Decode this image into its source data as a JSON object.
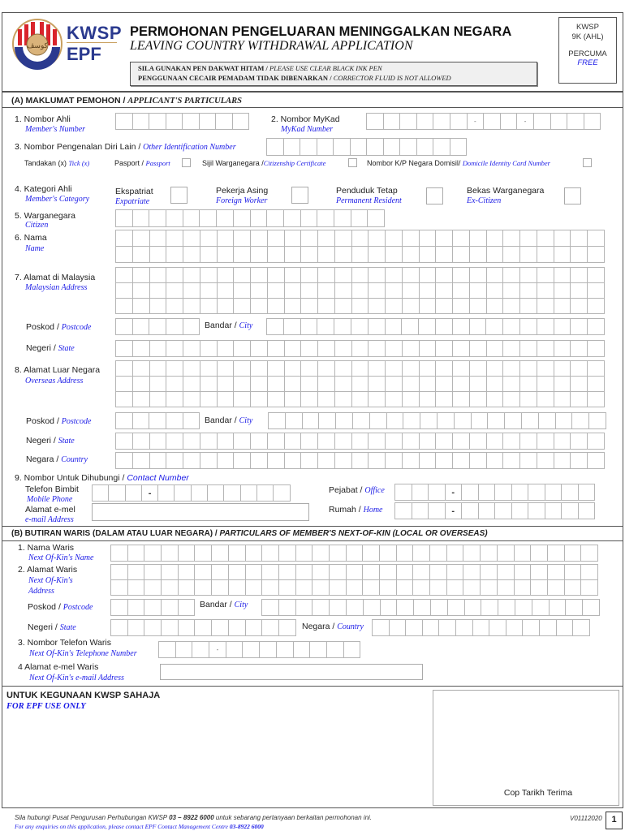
{
  "header": {
    "logo_text_top": "KWSP",
    "logo_text_bottom": "EPF",
    "title_ms": "PERMOHONAN PENGELUARAN MENINGGALKAN NEGARA",
    "title_en": "LEAVING COUNTRY WITHDRAWAL APPLICATION",
    "notice_line1_ms": "SILA GUNAKAN PEN DAKWAT HITAM",
    "notice_line1_en": "PLEASE USE CLEAR BLACK INK PEN",
    "notice_line2_ms": "PENGGUNAAN CECAIR PEMADAM TIDAK DIBENARKAN",
    "notice_line2_en": "CORRECTOR FLUID IS NOT ALLOWED",
    "separator": " / ",
    "form_code_line1": "KWSP",
    "form_code_line2": "9K (AHL)",
    "price_ms": "PERCUMA",
    "price_en": "FREE",
    "colors": {
      "brand_blue": "#2b3a8f",
      "brand_red": "#d9242b",
      "accent_gold": "#c9a060",
      "english_text": "#1a1ae6"
    }
  },
  "section_a": {
    "title_ms": "(A)  MAKLUMAT PEMOHON / ",
    "title_en": "APPLICANT'S PARTICULARS",
    "member_number": {
      "label": "1. Nombor Ahli",
      "label_en": "Member's Number",
      "cells": 8
    },
    "mykad": {
      "label": "2. Nombor MyKad",
      "label_en": "MyKad Number",
      "cells": 14,
      "separator": "-"
    },
    "other_id": {
      "label": "3. Nombor Pengenalan Diri Lain / ",
      "label_en": "Other Identification Number",
      "cells": 12
    },
    "tick": {
      "label": "Tandakan (x) ",
      "label_en": "Tick (x)",
      "options": [
        {
          "label": "Pasport / ",
          "label_en": "Passport",
          "checked": false
        },
        {
          "label": "Sijil Warganegara /",
          "label_en": "Citizenship Certificate",
          "checked": false
        },
        {
          "label": "Nombor K/P Negara Domisil/ ",
          "label_en": "Domicile Identity Card Number",
          "checked": false
        }
      ]
    },
    "category": {
      "label": "4. Kategori Ahli",
      "label_en": "Member's Category",
      "options": [
        {
          "label": "Ekspatriat",
          "label_en": "Expatriate",
          "checked": false
        },
        {
          "label": "Pekerja Asing",
          "label_en": "Foreign Worker",
          "checked": false
        },
        {
          "label": "Penduduk Tetap",
          "label_en": "Permanent Resident",
          "checked": false
        },
        {
          "label": "Bekas Warganegara",
          "label_en": "Ex-Citizen",
          "checked": false
        }
      ]
    },
    "citizen": {
      "label": "5. Warganegara",
      "label_en": "Citizen",
      "cells": 16
    },
    "name": {
      "label": "6. Nama",
      "label_en": "Name",
      "cells": 29,
      "rows": 2
    },
    "malaysian_address": {
      "label": "7. Alamat di Malaysia",
      "label_en": "Malaysian Address",
      "cells": 29,
      "rows": 3,
      "postcode_label": "Poskod / ",
      "postcode_label_en": "Postcode",
      "postcode_cells": 5,
      "city_label": "Bandar / ",
      "city_label_en": "City",
      "city_cells": 20,
      "state_label": "Negeri / ",
      "state_label_en": "State",
      "state_cells": 29
    },
    "overseas_address": {
      "label": "8. Alamat Luar Negara",
      "label_en": "Overseas Address",
      "cells": 29,
      "rows": 3,
      "postcode_label": "Poskod / ",
      "postcode_label_en": "Postcode",
      "postcode_cells": 5,
      "city_label": "Bandar / ",
      "city_label_en": "City",
      "city_cells": 20,
      "state_label": "Negeri / ",
      "state_label_en": "State",
      "state_cells": 29,
      "country_label": "Negara / ",
      "country_label_en": "Country",
      "country_cells": 29
    },
    "contact": {
      "label": "9. Nombor Untuk Dihubungi / ",
      "label_en": "Contact Number",
      "mobile_label": "Telefon Bimbit",
      "mobile_label_en": "Mobile Phone",
      "mobile_cells": 12,
      "email_label": "Alamat e-mel",
      "email_label_en": "e-mail Address",
      "email_value": "",
      "office_label": "Pejabat / ",
      "office_label_en": "Office",
      "office_cells": 12,
      "home_label": "Rumah / ",
      "home_label_en": "Home",
      "home_cells": 12,
      "separator": "-"
    }
  },
  "section_b": {
    "title_ms": "(B)  BUTIRAN WARIS (DALAM ATAU LUAR NEGARA) / ",
    "title_en": "PARTICULARS OF MEMBER'S NEXT-OF-KIN (LOCAL OR OVERSEAS)",
    "name": {
      "label": "1. Nama Waris",
      "label_en": "Next Of-Kin's Name",
      "cells": 29
    },
    "address": {
      "label": "2. Alamat Waris",
      "label_en_1": "Next Of-Kin's",
      "label_en_2": "Address",
      "cells": 29,
      "rows": 2,
      "postcode_label": "Poskod / ",
      "postcode_label_en": "Postcode",
      "postcode_cells": 5,
      "city_label": "Bandar / ",
      "city_label_en": "City",
      "city_cells": 20,
      "state_label": "Negeri / ",
      "state_label_en": "State",
      "state_cells": 11,
      "country_label": "Negara / ",
      "country_label_en": "Country",
      "country_cells": 13
    },
    "phone": {
      "label": "3. Nombor Telefon Waris",
      "label_en": "Next Of-Kin's Telephone Number",
      "cells": 12,
      "separator": "-"
    },
    "email": {
      "label": "4   Alamat e-mel Waris",
      "label_en": "Next Of-Kin's e-mail Address",
      "value": ""
    }
  },
  "office_use": {
    "title_ms": "UNTUK KEGUNAAN KWSP SAHAJA",
    "title_en": "FOR EPF USE ONLY",
    "stamp_label": "Cop Tarikh Terima"
  },
  "footer": {
    "line1_a": "Sila hubungi Pusat Pengurusan Perhubungan KWSP ",
    "line1_phone": "03 – 8922 6000",
    "line1_b": " untuk sebarang pertanyaan berkaitan permohonan ini.",
    "line2_a": "For any enquiries on this application, please contact EPF Contact Management Centre ",
    "line2_phone": "03-8922 6000",
    "version": "V01112020",
    "page_number": "1"
  }
}
